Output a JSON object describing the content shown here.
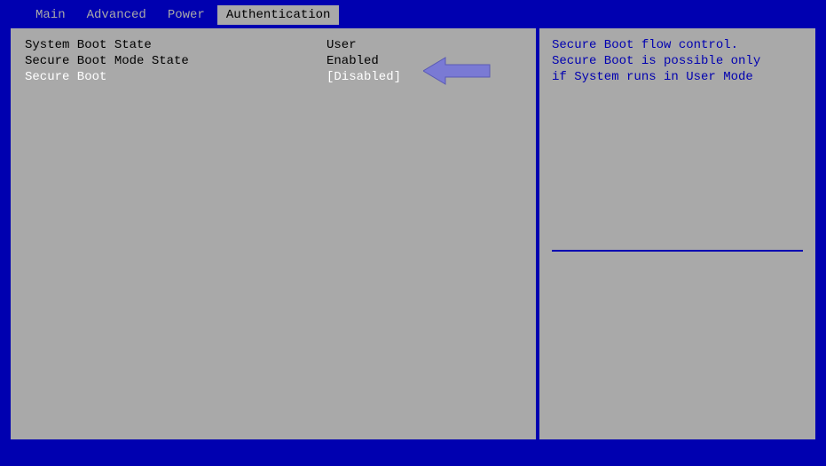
{
  "tabs": {
    "main": "Main",
    "advanced": "Advanced",
    "power": "Power",
    "authentication": "Authentication"
  },
  "settings": {
    "system_boot_state": {
      "label": "System Boot State",
      "value": "User"
    },
    "secure_boot_mode_state": {
      "label": "Secure Boot Mode State",
      "value": "Enabled"
    },
    "secure_boot": {
      "label": "Secure Boot",
      "value": "[Disabled]"
    }
  },
  "help": {
    "line1": "Secure Boot flow control.",
    "line2": "Secure Boot is possible only",
    "line3": "if System runs in User Mode"
  }
}
